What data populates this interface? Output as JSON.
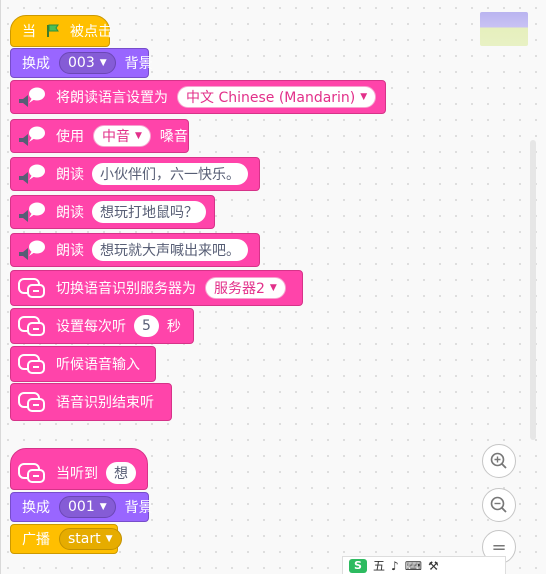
{
  "scripts": {
    "script1": {
      "flag_block": {
        "prefix": "当",
        "suffix": "被点击"
      },
      "switch_backdrop": {
        "label": "换成",
        "value": "003",
        "suffix": "背景"
      },
      "set_voice": {
        "label": "将朗读语言设置为",
        "value": "中文 Chinese (Mandarin)"
      },
      "use_voice": {
        "label": "使用",
        "value": "中音",
        "suffix": "嗓音"
      },
      "speak1": {
        "label": "朗读",
        "value": "小伙伴们，六一快乐。"
      },
      "speak2": {
        "label": "朗读",
        "value": "想玩打地鼠吗？"
      },
      "speak3": {
        "label": "朗读",
        "value": "想玩就大声喊出来吧。"
      },
      "switch_server": {
        "label": "切换语音识别服务器为",
        "value": "服务器2"
      },
      "set_listen": {
        "label": "设置每次听",
        "value": "5",
        "suffix": "秒"
      },
      "listen": {
        "label": "听候语音输入"
      },
      "stop_listen": {
        "label": "语音识别结束听"
      }
    },
    "script2": {
      "when_heard": {
        "label": "当听到",
        "value": "想"
      },
      "switch_backdrop": {
        "label": "换成",
        "value": "001",
        "suffix": "背景"
      },
      "broadcast": {
        "label": "广播",
        "value": "start"
      }
    }
  },
  "zoom": {
    "zoom_in": "zoom-in",
    "zoom_out": "zoom-out",
    "reset": "="
  },
  "bottom_bar": {
    "text1": "五",
    "text2": "♪",
    "text3": "⚒"
  },
  "colors": {
    "events": "#ffbf00",
    "looks": "#9966ff",
    "extension": "#ff44aa"
  }
}
